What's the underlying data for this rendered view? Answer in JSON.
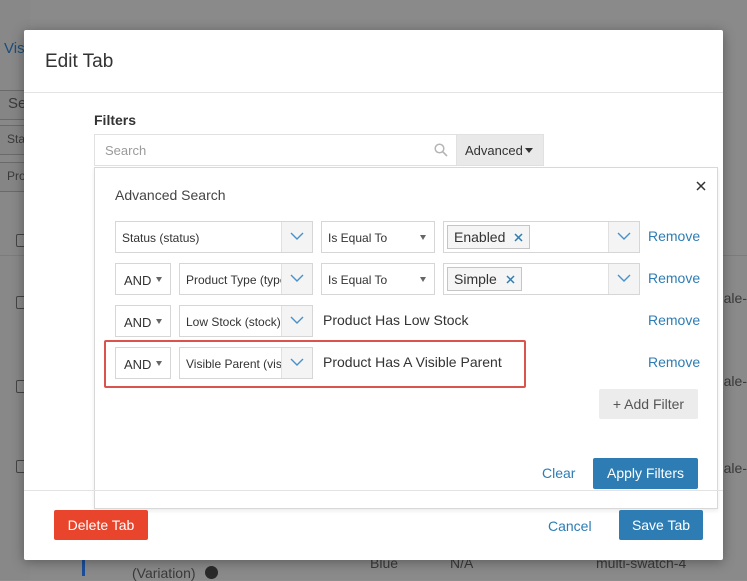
{
  "background": {
    "link_fragment": "Visi",
    "search_fragment": "Se",
    "sta_fragment": "Sta",
    "pro_fragment": "Pro",
    "right_fragments": [
      "ale-",
      "ale-",
      "ale-"
    ],
    "bottom_variation": "(Variation)",
    "bottom_color": "Blue",
    "bottom_na": "N/A",
    "bottom_sku": "multi-swatch-4"
  },
  "modal": {
    "title": "Edit Tab",
    "filters_label": "Filters",
    "search": {
      "placeholder": "Search",
      "value": ""
    },
    "advanced_button": "Advanced",
    "advanced_panel": {
      "title": "Advanced Search",
      "rows": [
        {
          "connector": "",
          "field": "Status (status)",
          "operator": "Is Equal To",
          "value_tag": "Enabled",
          "remove": "Remove"
        },
        {
          "connector": "AND",
          "field": "Product Type (type)",
          "operator": "Is Equal To",
          "value_tag": "Simple",
          "remove": "Remove"
        },
        {
          "connector": "AND",
          "field": "Low Stock (stock)",
          "text": "Product Has Low Stock",
          "remove": "Remove"
        },
        {
          "connector": "AND",
          "field": "Visible Parent (visible_parent)",
          "text": "Product Has A Visible Parent",
          "remove": "Remove"
        }
      ],
      "add_filter": "+ Add Filter",
      "clear": "Clear",
      "apply": "Apply Filters"
    },
    "delete_button": "Delete Tab",
    "cancel": "Cancel",
    "save_button": "Save Tab"
  },
  "colors": {
    "primary": "#2d7db4",
    "danger": "#e8452c",
    "highlight": "#d9534f"
  }
}
